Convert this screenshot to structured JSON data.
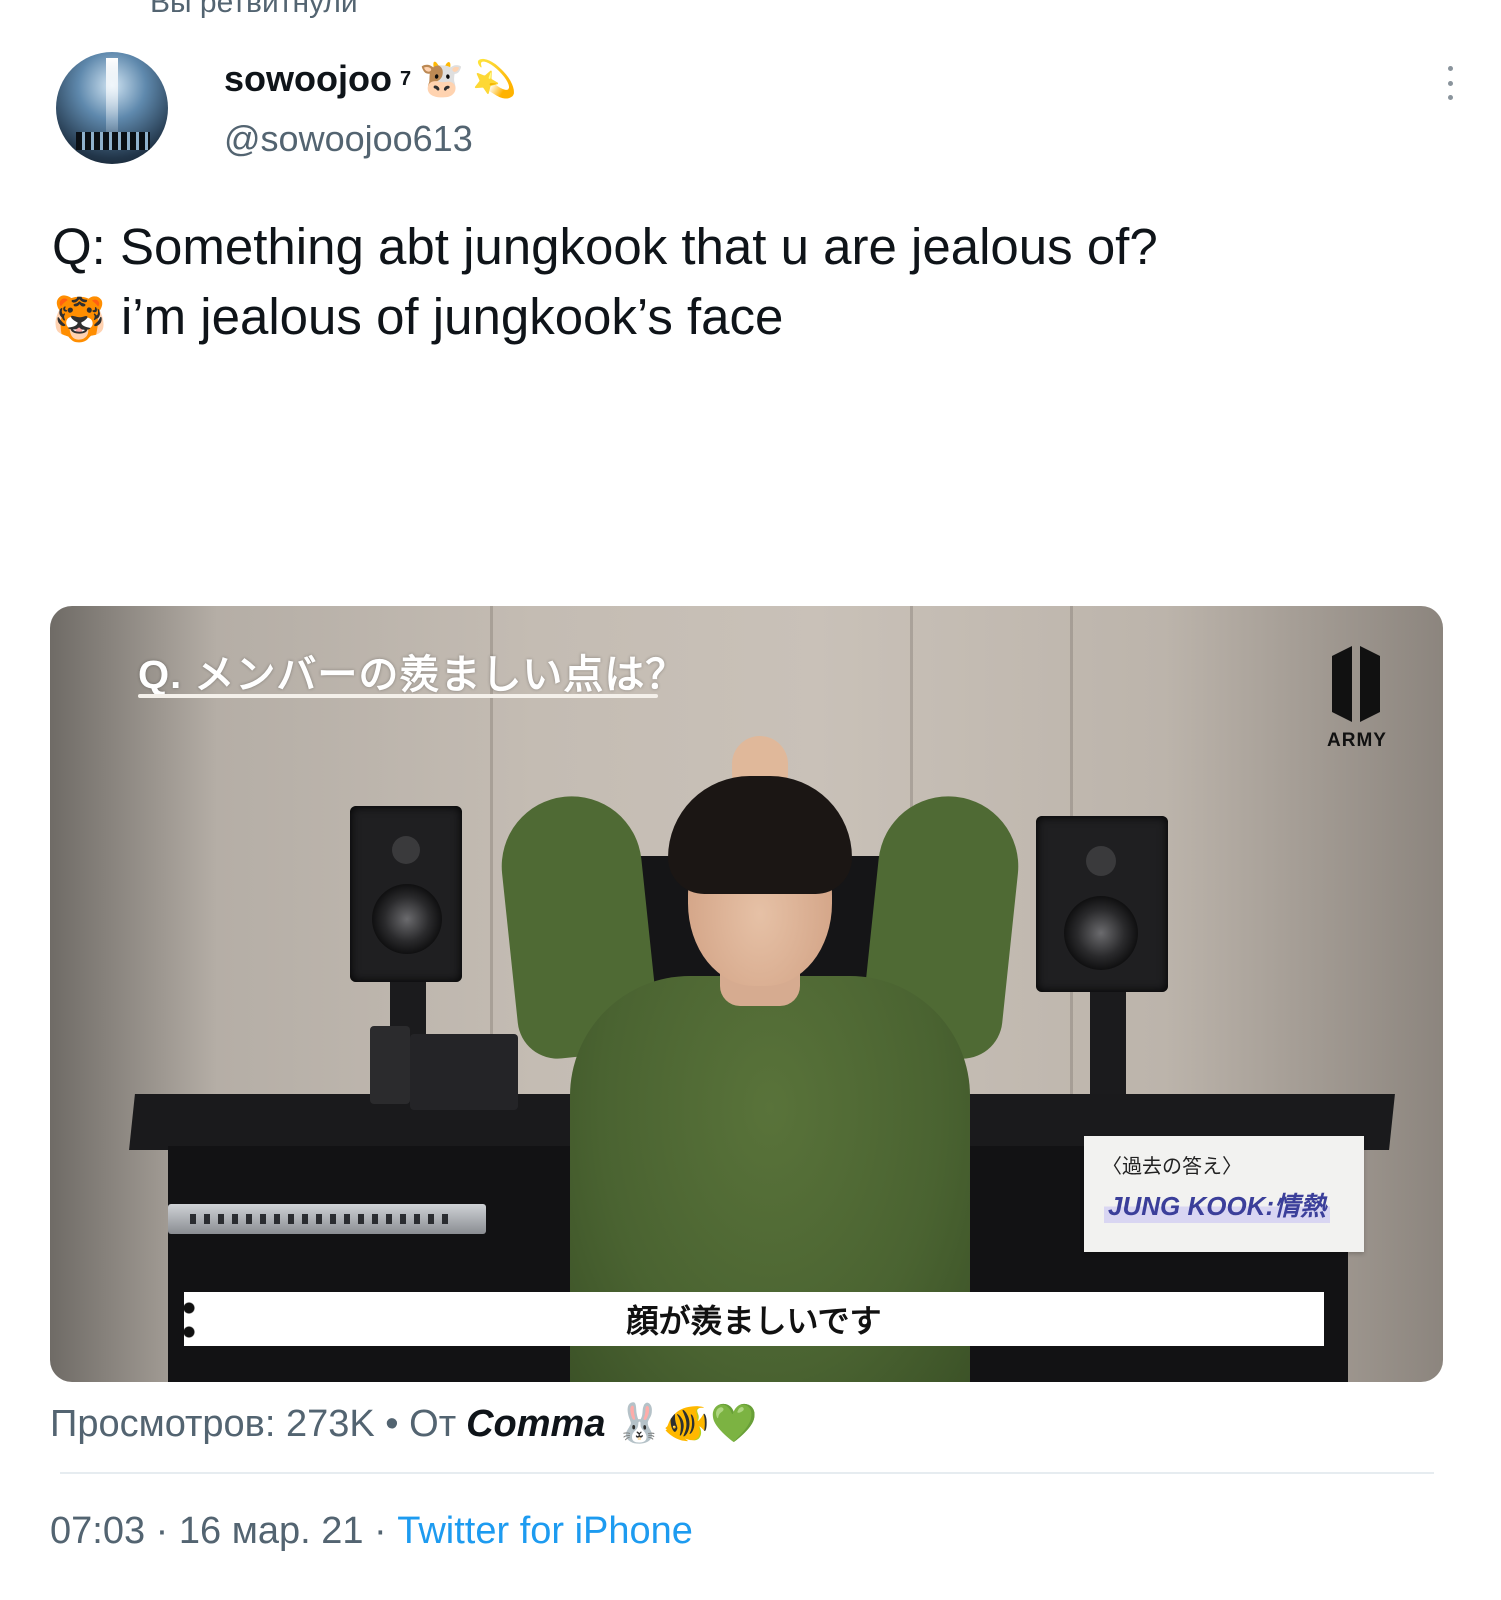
{
  "retweet_context": "Вы ретвитнули",
  "author": {
    "name": "sowoojoo",
    "name_superscript": "7",
    "name_emojis": [
      "🐮",
      "💫"
    ],
    "handle": "@sowoojoo613"
  },
  "tweet": {
    "line1": "Q: Something abt jungkook that u are jealous of?",
    "line2_emoji": "🐯",
    "line2": "i’m jealous of jungkook’s face"
  },
  "media": {
    "question_caption": "Q. メンバーの羨ましい点は？",
    "logo_text": "ARMY",
    "card_small": "〈過去の答え〉",
    "card_big": "JUNG KOOK:情熱",
    "bottom_caption": "顔が羨ましいです"
  },
  "footer": {
    "views": "Просмотров: 273K • От",
    "source": "Comma",
    "source_emojis": "🐰🐠💚",
    "time": "07:03 · 16 мар. 21 ·",
    "client": "Twitter for iPhone"
  },
  "colors": {
    "text_primary": "#0f1419",
    "text_secondary": "#536471",
    "link": "#1d9bf0"
  },
  "icons": [
    "more-vertical-icon",
    "army-logo-icon"
  ]
}
